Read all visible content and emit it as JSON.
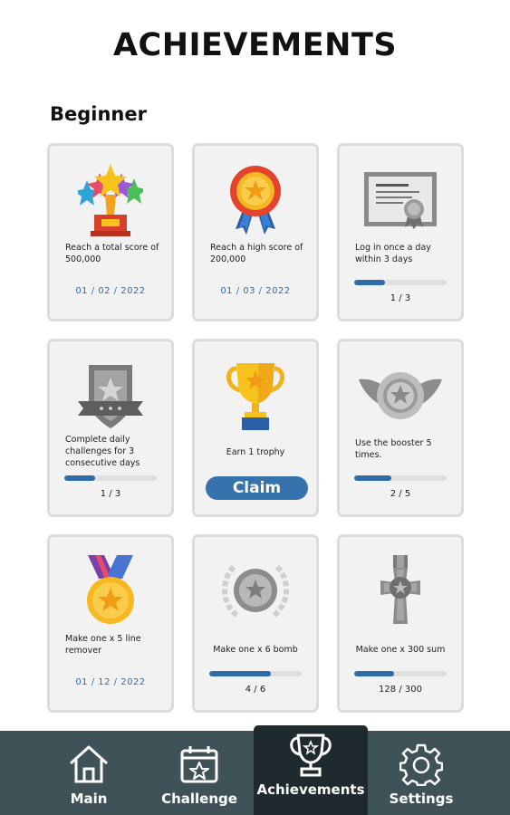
{
  "page_title": "ACHIEVEMENTS",
  "section_title": "Beginner",
  "accent_color": "#3673ad",
  "nav_background": "#3f5257",
  "achievements": [
    {
      "description": "Reach a total score of 500,000",
      "status": "completed",
      "date": "01 / 02 / 2022",
      "icon": "stars-trophy-icon"
    },
    {
      "description": "Reach a high score of 200,000",
      "status": "completed",
      "date": "01 / 03 / 2022",
      "icon": "ribbon-medal-icon"
    },
    {
      "description": "Log in once a day within 3 days",
      "status": "in-progress",
      "progress_text": "1 / 3",
      "progress_fraction": 0.33,
      "icon": "certificate-icon"
    },
    {
      "description": "Complete daily challenges for 3 consecutive days",
      "status": "in-progress",
      "progress_text": "1 / 3",
      "progress_fraction": 0.33,
      "icon": "shield-badge-icon"
    },
    {
      "description": "Earn 1 trophy",
      "status": "claimable",
      "button_label": "Claim",
      "icon": "gold-cup-icon"
    },
    {
      "description": "Use the booster 5 times.",
      "status": "in-progress",
      "progress_text": "2 / 5",
      "progress_fraction": 0.4,
      "icon": "winged-star-badge-icon"
    },
    {
      "description": "Make one x 5 line remover",
      "status": "completed",
      "date": "01 / 12 / 2022",
      "icon": "gold-star-medal-icon"
    },
    {
      "description": "Make one x 6 bomb",
      "status": "in-progress",
      "progress_text": "4 / 6",
      "progress_fraction": 0.67,
      "icon": "laurel-star-badge-icon"
    },
    {
      "description": "Make one x 300 sum",
      "status": "in-progress",
      "progress_text": "128 / 300",
      "progress_fraction": 0.43,
      "icon": "cross-medal-icon"
    }
  ],
  "nav": {
    "items": [
      {
        "label": "Main",
        "icon": "home-icon",
        "active": false
      },
      {
        "label": "Challenge",
        "icon": "calendar-star-icon",
        "active": false
      },
      {
        "label": "Achievements",
        "icon": "trophy-icon",
        "active": true
      },
      {
        "label": "Settings",
        "icon": "gear-icon",
        "active": false
      }
    ]
  }
}
